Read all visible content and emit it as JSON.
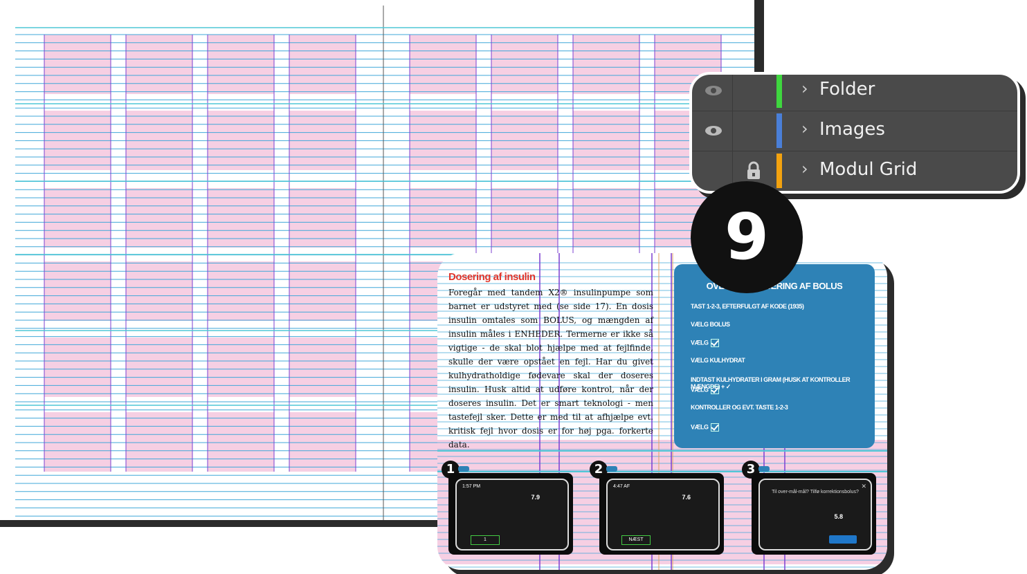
{
  "layers": [
    {
      "name": "Folder",
      "color": "#3fd63f",
      "eye": true,
      "lock": false
    },
    {
      "name": "Images",
      "color": "#4a7fd8",
      "eye": true,
      "lock": false
    },
    {
      "name": "Modul Grid",
      "color": "#f3a20f",
      "eye": false,
      "lock": true
    }
  ],
  "colors": {
    "module": "#f6cfe3",
    "baseline": "#3fa7d8",
    "column_guide": "#7b3fd1",
    "margin": "#d16fe0",
    "panel_bg": "#4a4a4a",
    "badge": "#111111",
    "info_box": "#2e82b6",
    "heading_red": "#e0352b"
  },
  "step_badge": "9",
  "article": {
    "title": "Dosering af insulin",
    "body": "Foregår med tandem X2® insulinpumpe som barnet er udstyret med (se side 17). En dosis insulin omtales som BOLUS, og mængden af insulin måles i ENHEDER. Termerne er ikke så vigtige - de skal blot hjælpe med at fejlfinde, skulle der være opstået en fejl. Har du givet kulhydratholdige fødevare skal der doseres insulin. Husk altid at udføre kontrol, når der doseres insulin. Det er smart teknologi - men tastefejl sker. Dette er med til at afhjælpe evt. kritisk fejl hvor dosis er for høj pga. forkerte data."
  },
  "bolus": {
    "title": "OVERSIGT DOSERING AF BOLUS",
    "steps": [
      "TAST 1-2-3, EFTERFULGT AF KODE (1935)",
      "VÆLG BOLUS",
      "VÆLG",
      "VÆLG KULHYDRAT",
      "INDTAST KULHYDRATER I GRAM (HUSK AT KONTROLLER MÆNGDE) + ✓",
      "VÆLG",
      "KONTROLLER OG EVT. TASTE 1-2-3",
      "VÆLG"
    ]
  },
  "screens": [
    {
      "number": "1",
      "header": "1:57 PM",
      "value": "7.9",
      "button": "1"
    },
    {
      "number": "2",
      "header": "4:47 AF",
      "value": "7.6",
      "button": "NÆST"
    },
    {
      "number": "3",
      "header": "",
      "dialog": "Til over-mål-mål? Tilfø korrektionsbolus?",
      "value": "5.8",
      "button": ""
    }
  ]
}
